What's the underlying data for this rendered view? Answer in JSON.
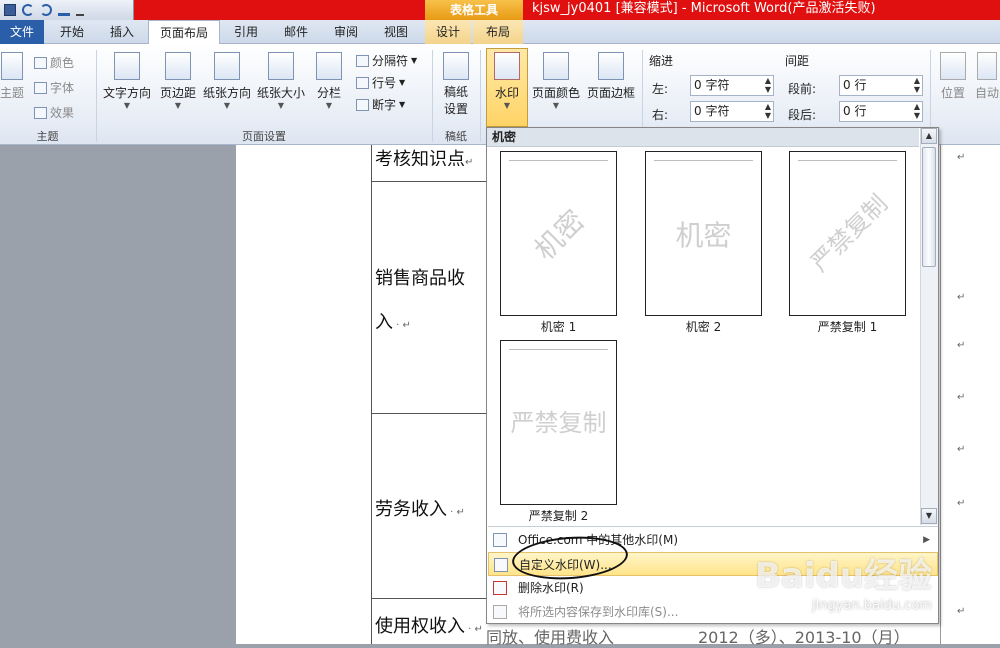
{
  "titlebar": {
    "context_tools": "表格工具",
    "document_title": "kjsw_jy0401 [兼容模式] - Microsoft Word(产品激活失败)"
  },
  "tabs": [
    {
      "label": "文件"
    },
    {
      "label": "开始"
    },
    {
      "label": "插入"
    },
    {
      "label": "页面布局"
    },
    {
      "label": "引用"
    },
    {
      "label": "邮件"
    },
    {
      "label": "审阅"
    },
    {
      "label": "视图"
    },
    {
      "label": "设计"
    },
    {
      "label": "布局"
    }
  ],
  "ribbon": {
    "theme_group": {
      "label": "主题",
      "theme_btn": "主题",
      "colors": "颜色",
      "fonts": "字体",
      "effects": "效果"
    },
    "page_setup_group": {
      "label": "页面设置",
      "text_direction": "文字方向",
      "margins": "页边距",
      "orientation": "纸张方向",
      "size": "纸张大小",
      "columns": "分栏",
      "breaks": "分隔符",
      "line_numbers": "行号",
      "hyphenation": "断字"
    },
    "draft_group": {
      "label": "稿纸",
      "draft_settings": "稿纸设置"
    },
    "background_group": {
      "watermark": "水印",
      "page_color": "页面颜色",
      "page_borders": "页面边框"
    },
    "paragraph_group": {
      "indent_title": "缩进",
      "left_label": "左:",
      "left_value": "0 字符",
      "right_label": "右:",
      "right_value": "0 字符",
      "spacing_title": "间距",
      "before_label": "段前:",
      "before_value": "0 行",
      "after_label": "段后:",
      "after_value": "0 行"
    },
    "arrange_group": {
      "position": "位置",
      "auto_wrap": "自动"
    }
  },
  "document": {
    "row1": "考核知识点",
    "row2_a": "销售商品收",
    "row2_b": "入",
    "row3": "劳务收入",
    "row4": "使用权收入",
    "row4_tail": "同放、使用费收入",
    "row4_right": "2012（多）、2013-10（月）"
  },
  "watermark_menu": {
    "header": "机密",
    "items": [
      {
        "text": "机密",
        "caption": "机密 1"
      },
      {
        "text": "机密",
        "caption": "机密 2"
      },
      {
        "text": "严禁复制",
        "caption": "严禁复制 1"
      },
      {
        "text": "严禁复制",
        "caption": "严禁复制 2"
      }
    ],
    "more_online": "Office.com 中的其他水印(M)",
    "custom": "自定义水印(W)...",
    "remove": "删除水印(R)",
    "save_selection": "将所选内容保存到水印库(S)..."
  },
  "watermark_site": {
    "brand": "Baidu经验",
    "url": "jingyan.baidu.com"
  }
}
